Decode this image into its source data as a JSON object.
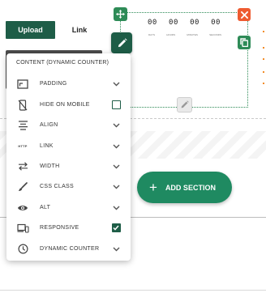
{
  "tabs": {
    "upload": "Upload",
    "link": "Link"
  },
  "counter": {
    "values": [
      "00",
      "00",
      "00",
      "00"
    ],
    "units": [
      "DAYS",
      "HOURS",
      "MINUTES",
      "SECONDS"
    ]
  },
  "add_section": {
    "label": "ADD SECTION"
  },
  "menu": {
    "title": "CONTENT (DYNAMIC COUNTER)",
    "items": [
      {
        "label": "PADDING",
        "icon": "padding-icon",
        "control": "chevron"
      },
      {
        "label": "HIDE ON MOBILE",
        "icon": "hide-mobile-icon",
        "control": "checkbox",
        "checked": false
      },
      {
        "label": "ALIGN",
        "icon": "align-icon",
        "control": "chevron"
      },
      {
        "label": "LINK",
        "icon": "http-icon",
        "icon_text": "HTTP",
        "control": "chevron"
      },
      {
        "label": "WIDTH",
        "icon": "width-arrows-icon",
        "control": "chevron"
      },
      {
        "label": "CSS CLASS",
        "icon": "brush-icon",
        "control": "chevron"
      },
      {
        "label": "ALT",
        "icon": "eye-icon",
        "control": "chevron"
      },
      {
        "label": "RESPONSIVE",
        "icon": "devices-icon",
        "control": "checkbox",
        "checked": true
      },
      {
        "label": "DYNAMIC COUNTER",
        "icon": "clock-icon",
        "control": "chevron"
      }
    ]
  },
  "colors": {
    "brand_dark": "#1e5d47",
    "brand": "#2e8b57",
    "danger": "#ee5b30",
    "accent": "#f28c28"
  }
}
